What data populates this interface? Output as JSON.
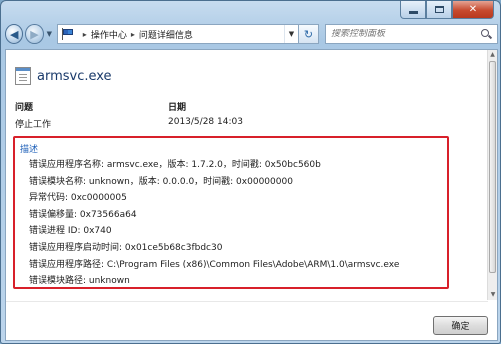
{
  "window": {
    "close_glyph": "✕"
  },
  "nav": {
    "back_glyph": "◀",
    "forward_glyph": "▶",
    "breadcrumbs": [
      "操作中心",
      "问题详细信息"
    ],
    "search_placeholder": "搜索控制面板",
    "refresh_glyph": "↻"
  },
  "app": {
    "name": "armsvc.exe"
  },
  "summary": {
    "problem_label": "问题",
    "problem_value": "停止工作",
    "date_label": "日期",
    "date_value": "2013/5/28 14:03"
  },
  "description": {
    "header": "描述",
    "lines": [
      "错误应用程序名称: armsvc.exe，版本: 1.7.2.0，时间戳: 0x50bc560b",
      "错误模块名称: unknown，版本: 0.0.0.0，时间戳: 0x00000000",
      "异常代码: 0xc0000005",
      "错误偏移量: 0x73566a64",
      "错误进程 ID: 0x740",
      "错误应用程序启动时间: 0x01ce5b68c3fbdc30",
      "错误应用程序路径: C:\\Program Files (x86)\\Common Files\\Adobe\\ARM\\1.0\\armsvc.exe",
      "错误模块路径: unknown"
    ]
  },
  "footer": {
    "ok_label": "确定"
  },
  "colors": {
    "highlight_border": "#d8202a",
    "link_blue": "#1d5fb8"
  }
}
